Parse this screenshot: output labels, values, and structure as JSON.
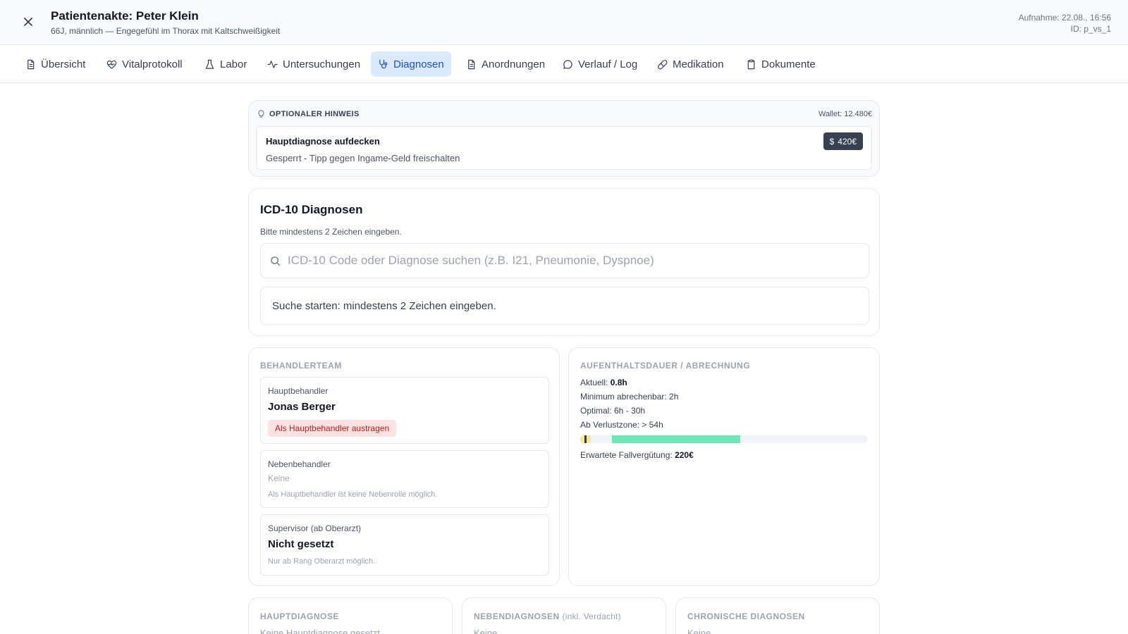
{
  "header": {
    "title": "Patientenakte: Peter Klein",
    "subtitle": "66J, männlich — Engegefühl im Thorax mit Kaltschweißigkeit",
    "admission": "Aufnahme: 22.08., 16:56",
    "id": "ID: p_vs_1"
  },
  "tabs": [
    {
      "label": "Übersicht",
      "icon": "document-icon"
    },
    {
      "label": "Vitalprotokoll",
      "icon": "heart-pulse-icon"
    },
    {
      "label": "Labor",
      "icon": "flask-icon"
    },
    {
      "label": "Untersuchungen",
      "icon": "activity-icon"
    },
    {
      "label": "Diagnosen",
      "icon": "stethoscope-icon",
      "active": true
    },
    {
      "label": "Anordnungen",
      "icon": "document-icon"
    },
    {
      "label": "Verlauf / Log",
      "icon": "chat-bubble-icon"
    },
    {
      "label": "Medikation",
      "icon": "pill-icon"
    },
    {
      "label": "Dokumente",
      "icon": "clipboard-icon"
    }
  ],
  "hint": {
    "heading": "OPTIONALER HINWEIS",
    "wallet": "Wallet: 12.480€",
    "title": "Hauptdiagnose aufdecken",
    "subtitle": "Gesperrt - Tipp gegen Ingame-Geld freischalten",
    "price": "420€"
  },
  "icd": {
    "title": "ICD-10 Diagnosen",
    "help": "Bitte mindestens 2 Zeichen eingeben.",
    "search_value": "",
    "search_placeholder": "ICD-10 Code oder Diagnose suchen (z.B. I21, Pneumonie, Dyspnoe)",
    "result_text": "Suche starten: mindestens 2 Zeichen eingeben."
  },
  "team": {
    "heading": "BEHANDLERTEAM",
    "main": {
      "label": "Hauptbehandler",
      "value": "Jonas Berger",
      "remove_label": "Als Hauptbehandler austragen"
    },
    "secondary": {
      "label": "Nebenbehandler",
      "value": "Keine",
      "note": "Als Hauptbehandler ist keine Nebenrolle möglich."
    },
    "supervisor": {
      "label": "Supervisor (ab Oberarzt)",
      "value": "Nicht gesetzt",
      "note": "Nur ab Rang Oberarzt möglich."
    }
  },
  "stay": {
    "heading": "AUFENTHALTSDAUER / ABRECHNUNG",
    "current_label": "Aktuell:",
    "current_value": "0.8h",
    "minimum": "Minimum abrechenbar: 2h",
    "optimal": "Optimal: 6h - 30h",
    "loss": "Ab Verlustzone: > 54h",
    "expected_label": "Erwartete Fallvergütung:",
    "expected_value": "220€",
    "bar": {
      "current_hours": 0.8,
      "minimum_hours": 2,
      "optimal_start_hours": 6,
      "optimal_end_hours": 30,
      "loss_hours": 54,
      "colors": {
        "track": "#f1f5f9",
        "early": "#fde68a",
        "current": "#1e3a8a",
        "optimal": "#6ee7b7"
      }
    }
  },
  "bottom": {
    "main_dx": {
      "heading": "HAUPTDIAGNOSE",
      "value": "Keine Hauptdiagnose gesetzt"
    },
    "side_dx": {
      "heading": "NEBENDIAGNOSEN",
      "heading_extra": "(inkl. Verdacht)",
      "value": "Keine"
    },
    "chronic_dx": {
      "heading": "CHRONISCHE DIAGNOSEN",
      "value": "Keine"
    }
  },
  "colors": {
    "accent": "#1d4ed8",
    "accent_bg": "#dbeafe",
    "danger": "#b91c1c",
    "danger_bg": "#fee2e2"
  }
}
